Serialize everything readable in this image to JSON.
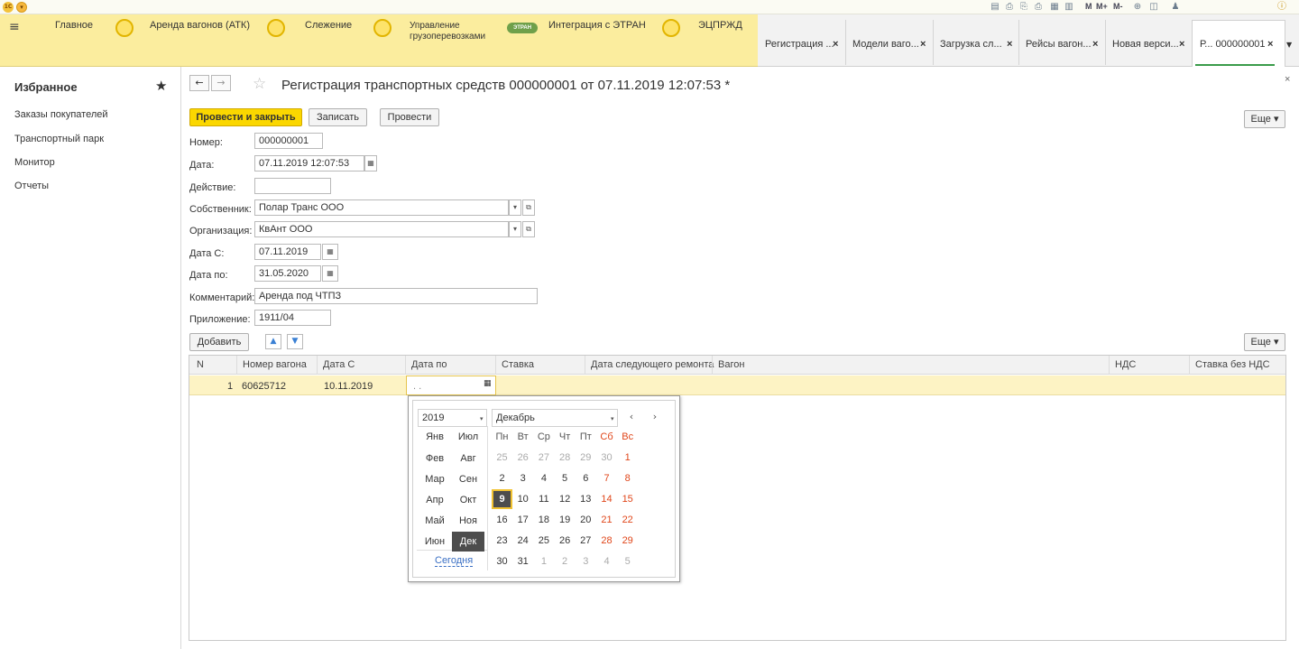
{
  "titlebar": {
    "logo": "1С",
    "menu_icon": "☰",
    "icons": [
      "save-icon",
      "print-icon",
      "print-preview-icon",
      "print-setup-icon",
      "calculator-icon",
      "calendar-icon"
    ],
    "memory": [
      "M",
      "M+",
      "M-"
    ],
    "right_icon": "i"
  },
  "sections": [
    {
      "label": "Главное"
    },
    {
      "label": "Аренда вагонов (АТК)"
    },
    {
      "label": "Слежение"
    },
    {
      "label_line1": "Управление",
      "label_line2": "грузоперевозками"
    },
    {
      "label": "Интеграция с ЭТРАН",
      "logo_text": "ЭТРАН"
    },
    {
      "label": "ЭЦПРЖД"
    }
  ],
  "tabs": [
    {
      "label": "Регистрация ...",
      "close": "×"
    },
    {
      "label": "Модели ваго...",
      "close": "×"
    },
    {
      "label": "Загрузка сл...",
      "close": "×"
    },
    {
      "label": "Рейсы вагон...",
      "close": "×"
    },
    {
      "label": "Новая верси...",
      "close": "×"
    },
    {
      "label": "Р... 000000001",
      "close": "×"
    }
  ],
  "favorites": {
    "title": "Избранное",
    "items": [
      "Заказы покупателей",
      "Транспортный парк",
      "Монитор",
      "Отчеты"
    ]
  },
  "form": {
    "title": "Регистрация транспортных средств 000000001 от 07.11.2019 12:07:53 *",
    "close": "×",
    "buttons": {
      "post_close": "Провести и закрыть",
      "save": "Записать",
      "post": "Провести",
      "more": "Еще"
    },
    "fields": {
      "number": {
        "label": "Номер:",
        "value": "000000001"
      },
      "date": {
        "label": "Дата:",
        "value": "07.11.2019 12:07:53"
      },
      "action": {
        "label": "Действие:",
        "value": ""
      },
      "owner": {
        "label": "Собственник:",
        "value": "Полар Транс ООО"
      },
      "organization": {
        "label": "Организация:",
        "value": "КвАнт ООО"
      },
      "date_from": {
        "label": "Дата С:",
        "value": "07.11.2019"
      },
      "date_to": {
        "label": "Дата по:",
        "value": "31.05.2020"
      },
      "comment": {
        "label": "Комментарий:",
        "value": "Аренда под ЧТПЗ"
      },
      "appendix": {
        "label": "Приложение:",
        "value": "1911/04"
      }
    },
    "table_toolbar": {
      "add": "Добавить",
      "more": "Еще"
    }
  },
  "table": {
    "columns": [
      "N",
      "Номер вагона",
      "Дата С",
      "Дата по",
      "Ставка",
      "Дата следующего ремонта",
      "Вагон",
      "НДС",
      "Ставка без НДС"
    ],
    "rows": [
      {
        "n": "1",
        "wagon_number": "60625712",
        "date_from": "10.11.2019",
        "date_to": ". .",
        "rate": "",
        "next_repair": "",
        "wagon": "",
        "vat": "",
        "rate_no_vat": ""
      }
    ]
  },
  "calendar": {
    "year": "2019",
    "month": "Декабрь",
    "nav_prev": "‹",
    "nav_next": "›",
    "months": [
      "Янв",
      "Июл",
      "Фев",
      "Авг",
      "Мар",
      "Сен",
      "Апр",
      "Окт",
      "Май",
      "Ноя",
      "Июн",
      "Дек"
    ],
    "selected_month": "Дек",
    "weekdays": [
      "Пн",
      "Вт",
      "Ср",
      "Чт",
      "Пт",
      "Сб",
      "Вс"
    ],
    "weeks": [
      [
        "25",
        "26",
        "27",
        "28",
        "29",
        "30",
        "1"
      ],
      [
        "2",
        "3",
        "4",
        "5",
        "6",
        "7",
        "8"
      ],
      [
        "9",
        "10",
        "11",
        "12",
        "13",
        "14",
        "15"
      ],
      [
        "16",
        "17",
        "18",
        "19",
        "20",
        "21",
        "22"
      ],
      [
        "23",
        "24",
        "25",
        "26",
        "27",
        "28",
        "29"
      ],
      [
        "30",
        "31",
        "1",
        "2",
        "3",
        "4",
        "5"
      ]
    ],
    "selected_day": "9",
    "today_label": "Сегодня"
  },
  "colors": {
    "accent": "#fbd700",
    "sections_bg": "#fbed9e",
    "row_highlight": "#fdf3c4",
    "weekend": "#e0461a",
    "active_tab_line": "#3a9b4a"
  }
}
